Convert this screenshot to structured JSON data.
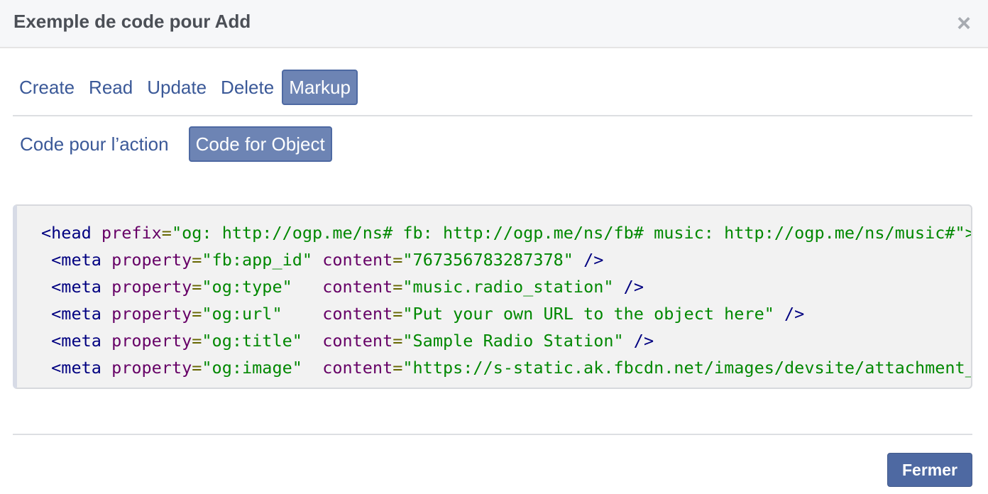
{
  "dialog": {
    "title": "Exemple de code pour Add",
    "close_glyph": "×"
  },
  "tabs": [
    {
      "label": "Create",
      "active": false
    },
    {
      "label": "Read",
      "active": false
    },
    {
      "label": "Update",
      "active": false
    },
    {
      "label": "Delete",
      "active": false
    },
    {
      "label": "Markup",
      "active": true
    }
  ],
  "subtabs": [
    {
      "label": "Code pour l’action",
      "active": false
    },
    {
      "label": "Code for Object",
      "active": true
    }
  ],
  "code": {
    "line1": {
      "tag": "<head",
      "attr": "prefix",
      "eq": "=",
      "str": "\"og: http://ogp.me/ns# fb: http://ogp.me/ns/fb# music: http://ogp.me/ns/music#\">"
    },
    "meta_lines": [
      {
        "tag": "<meta",
        "attr": "property",
        "eq": "=",
        "prop": "\"fb:app_id\"",
        "pad": " ",
        "cattr": "content",
        "ceq": "=",
        "cval": "\"767356783287378\"",
        "close": " />"
      },
      {
        "tag": "<meta",
        "attr": "property",
        "eq": "=",
        "prop": "\"og:type\"",
        "pad": "   ",
        "cattr": "content",
        "ceq": "=",
        "cval": "\"music.radio_station\"",
        "close": " />"
      },
      {
        "tag": "<meta",
        "attr": "property",
        "eq": "=",
        "prop": "\"og:url\"",
        "pad": "    ",
        "cattr": "content",
        "ceq": "=",
        "cval": "\"Put your own URL to the object here\"",
        "close": " />"
      },
      {
        "tag": "<meta",
        "attr": "property",
        "eq": "=",
        "prop": "\"og:title\"",
        "pad": "  ",
        "cattr": "content",
        "ceq": "=",
        "cval": "\"Sample Radio Station\"",
        "close": " />"
      },
      {
        "tag": "<meta",
        "attr": "property",
        "eq": "=",
        "prop": "\"og:image\"",
        "pad": "  ",
        "cattr": "content",
        "ceq": "=",
        "cval": "\"https://s-static.ak.fbcdn.net/images/devsite/attachment_blank.png\"",
        "close": " />"
      }
    ]
  },
  "footer": {
    "close_label": "Fermer"
  },
  "colors": {
    "accent": "#4e69a2",
    "tab_active_bg": "#6d84b4",
    "link": "#3b5998"
  }
}
